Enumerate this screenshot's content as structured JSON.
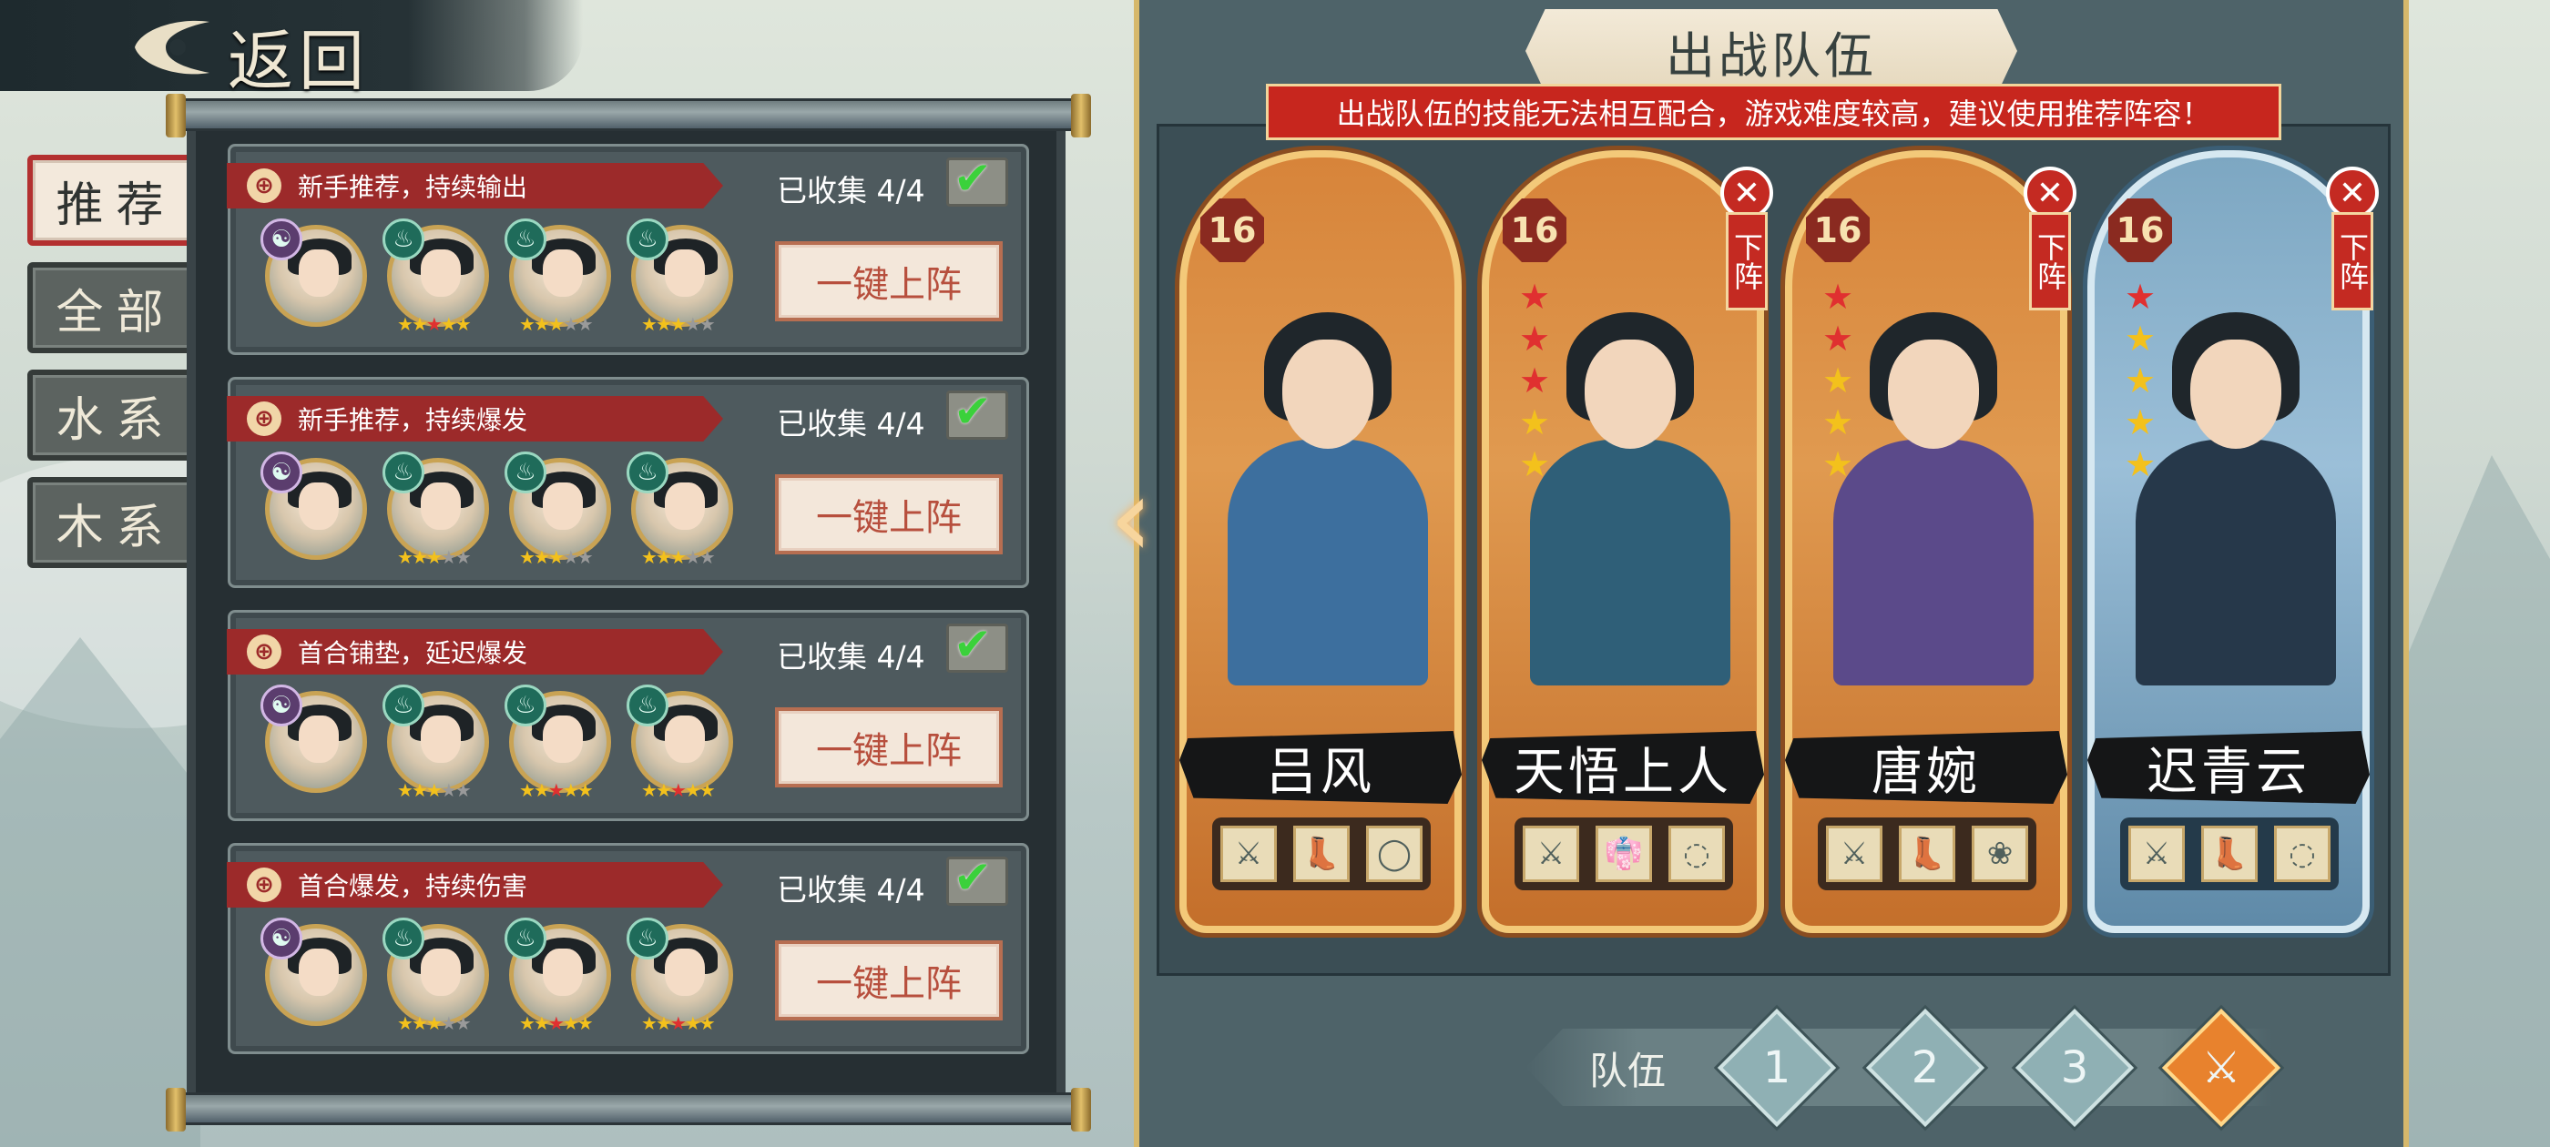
{
  "back": {
    "label": "返回"
  },
  "tabs": [
    {
      "label": "推荐",
      "active": true
    },
    {
      "label": "全部",
      "active": false
    },
    {
      "label": "水系",
      "active": false
    },
    {
      "label": "木系",
      "active": false
    }
  ],
  "lineups": [
    {
      "title": "新手推荐，持续输出",
      "collected": "已收集 4/4",
      "button": "一键上阵",
      "members": [
        {
          "elem": "☯",
          "stars": "",
          "yy": true
        },
        {
          "elem": "♨",
          "stars": "★★★★★",
          "colors": "yyryy"
        },
        {
          "elem": "♨",
          "stars": "★★★★★",
          "colors": "yyygg"
        },
        {
          "elem": "♨",
          "stars": "★★★★★",
          "colors": "yyygg"
        }
      ]
    },
    {
      "title": "新手推荐，持续爆发",
      "collected": "已收集 4/4",
      "button": "一键上阵",
      "members": [
        {
          "elem": "☯",
          "stars": "",
          "yy": true
        },
        {
          "elem": "♨",
          "stars": "★★★★★",
          "colors": "yyygg"
        },
        {
          "elem": "♨",
          "stars": "★★★★★",
          "colors": "yyygg"
        },
        {
          "elem": "♨",
          "stars": "★★★★★",
          "colors": "yyygg"
        }
      ]
    },
    {
      "title": "首合铺垫，延迟爆发",
      "collected": "已收集 4/4",
      "button": "一键上阵",
      "members": [
        {
          "elem": "☯",
          "stars": "",
          "yy": true
        },
        {
          "elem": "♨",
          "stars": "★★★★★",
          "colors": "yyygg"
        },
        {
          "elem": "♨",
          "stars": "★★★★★",
          "colors": "yyryy"
        },
        {
          "elem": "♨",
          "stars": "★★★★★",
          "colors": "yyryy"
        }
      ]
    },
    {
      "title": "首合爆发，持续伤害",
      "collected": "已收集 4/4",
      "button": "一键上阵",
      "members": [
        {
          "elem": "☯",
          "stars": "",
          "yy": true
        },
        {
          "elem": "♨",
          "stars": "★★★★★",
          "colors": "yyygg"
        },
        {
          "elem": "♨",
          "stars": "★★★★★",
          "colors": "yyryy"
        },
        {
          "elem": "♨",
          "stars": "★★★★★",
          "colors": "yyryy"
        }
      ]
    }
  ],
  "team": {
    "title": "出战队伍",
    "warning": "出战队伍的技能无法相互配合，游戏难度较高，建议使用推荐阵容！",
    "remove_label": "下阵",
    "heroes": [
      {
        "name": "吕风",
        "level": "16",
        "stars": "",
        "removable": false,
        "equips": [
          "⚔",
          "👢",
          "◯"
        ],
        "theme": "orange",
        "robe": "#3d6f9e"
      },
      {
        "name": "天悟上人",
        "level": "16",
        "stars": "rrryy",
        "removable": true,
        "equips": [
          "⚔",
          "👘",
          "◌"
        ],
        "theme": "orange",
        "robe": "#2f5f78"
      },
      {
        "name": "唐婉",
        "level": "16",
        "stars": "rryyy",
        "removable": true,
        "equips": [
          "⚔",
          "👢",
          "❀"
        ],
        "theme": "orange",
        "robe": "#5b4a8a"
      },
      {
        "name": "迟青云",
        "level": "16",
        "stars": "ryyyy",
        "removable": true,
        "equips": [
          "⚔",
          "👢",
          "◌"
        ],
        "theme": "blue",
        "robe": "#26384a"
      }
    ]
  },
  "teambar": {
    "label": "队伍",
    "slots": [
      "1",
      "2",
      "3",
      "⚔"
    ],
    "active_index": 3
  },
  "colors": {
    "accent_red": "#c42a22",
    "panel": "#4e6369",
    "gold": "#d6b86b"
  }
}
